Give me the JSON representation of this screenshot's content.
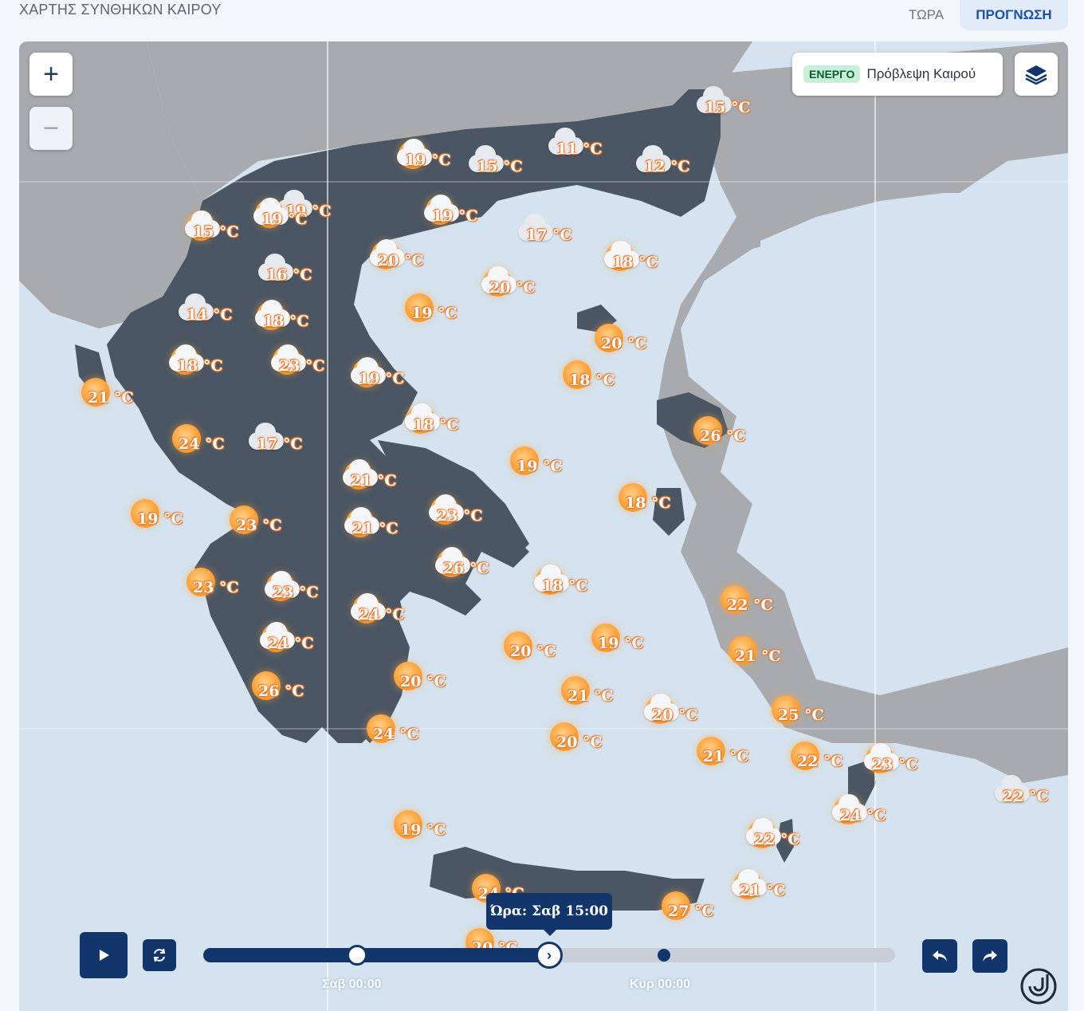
{
  "header": {
    "title": "ΧΑΡΤΗΣ ΣΥΝΘΗΚΩΝ ΚΑΙΡΟΥ",
    "tabs": [
      {
        "label": "ΤΩΡΑ",
        "active": false
      },
      {
        "label": "ΠΡΟΓΝΩΣΗ",
        "active": true
      }
    ]
  },
  "map": {
    "zoom_in_label": "+",
    "zoom_out_label": "−",
    "layer_status_badge": "ΕΝΕΡΓΟ",
    "layer_name": "Πρόβλεψη Καιρού",
    "layers_icon": "layers-icon",
    "colors": {
      "sea": "#d4e3ef",
      "greece_land": "#4a5663",
      "neighbor_land": "#a8aaad",
      "accent": "#12356b"
    }
  },
  "stations": [
    {
      "temp": "15 °C",
      "cond": "cloudy"
    },
    {
      "temp": "19 °C",
      "cond": "partly"
    },
    {
      "temp": "15 °C",
      "cond": "cloudy"
    },
    {
      "temp": "11 °C",
      "cond": "cloudy"
    },
    {
      "temp": "12 °C",
      "cond": "cloudy"
    },
    {
      "temp": "19 °C",
      "cond": "partly"
    },
    {
      "temp": "15 °C",
      "cond": "partly"
    },
    {
      "temp": "19 °C",
      "cond": "cloudy"
    },
    {
      "temp": "17 °C",
      "cond": "cloudy"
    },
    {
      "temp": "16 °C",
      "cond": "cloudy"
    },
    {
      "temp": "20 °C",
      "cond": "partly"
    },
    {
      "temp": "18 °C",
      "cond": "partly"
    },
    {
      "temp": "19 °C",
      "cond": "partly"
    },
    {
      "temp": "14 °C",
      "cond": "cloudy"
    },
    {
      "temp": "18 °C",
      "cond": "partly"
    },
    {
      "temp": "19 °C",
      "cond": "sunny"
    },
    {
      "temp": "20 °C",
      "cond": "partly"
    },
    {
      "temp": "20 °C",
      "cond": "sunny"
    },
    {
      "temp": "18 °C",
      "cond": "partly"
    },
    {
      "temp": "23 °C",
      "cond": "partly"
    },
    {
      "temp": "19 °C",
      "cond": "partly"
    },
    {
      "temp": "18 °C",
      "cond": "sunny"
    },
    {
      "temp": "21 °C",
      "cond": "sunny"
    },
    {
      "temp": "18 °C",
      "cond": "partly"
    },
    {
      "temp": "26 °C",
      "cond": "sunny"
    },
    {
      "temp": "24 °C",
      "cond": "sunny"
    },
    {
      "temp": "17 °C",
      "cond": "cloudy"
    },
    {
      "temp": "21 °C",
      "cond": "partly"
    },
    {
      "temp": "19 °C",
      "cond": "sunny"
    },
    {
      "temp": "19 °C",
      "cond": "sunny"
    },
    {
      "temp": "23 °C",
      "cond": "sunny"
    },
    {
      "temp": "23 °C",
      "cond": "partly"
    },
    {
      "temp": "21 °C",
      "cond": "partly"
    },
    {
      "temp": "18 °C",
      "cond": "sunny"
    },
    {
      "temp": "26 °C",
      "cond": "partly"
    },
    {
      "temp": "23 °C",
      "cond": "sunny"
    },
    {
      "temp": "23 °C",
      "cond": "partly"
    },
    {
      "temp": "18 °C",
      "cond": "partly"
    },
    {
      "temp": "22 °C",
      "cond": "sunny"
    },
    {
      "temp": "24 °C",
      "cond": "partly"
    },
    {
      "temp": "24 °C",
      "cond": "partly"
    },
    {
      "temp": "20 °C",
      "cond": "sunny"
    },
    {
      "temp": "19 °C",
      "cond": "sunny"
    },
    {
      "temp": "21 °C",
      "cond": "sunny"
    },
    {
      "temp": "20 °C",
      "cond": "partly"
    },
    {
      "temp": "26 °C",
      "cond": "sunny"
    },
    {
      "temp": "21 °C",
      "cond": "sunny"
    },
    {
      "temp": "20 °C",
      "cond": "sunny"
    },
    {
      "temp": "25 °C",
      "cond": "sunny"
    },
    {
      "temp": "24 °C",
      "cond": "sunny"
    },
    {
      "temp": "20 °C",
      "cond": "sunny"
    },
    {
      "temp": "21 °C",
      "cond": "sunny"
    },
    {
      "temp": "22 °C",
      "cond": "sunny"
    },
    {
      "temp": "23 °C",
      "cond": "partly"
    },
    {
      "temp": "22 °C",
      "cond": "cloudy"
    },
    {
      "temp": "24 °C",
      "cond": "partly"
    },
    {
      "temp": "19 °C",
      "cond": "sunny"
    },
    {
      "temp": "22 °C",
      "cond": "partly"
    },
    {
      "temp": "24 °C",
      "cond": "sunny"
    },
    {
      "temp": "27 °C",
      "cond": "sunny"
    },
    {
      "temp": "21 °C",
      "cond": "partly"
    },
    {
      "temp": "20 °C",
      "cond": "sunny"
    }
  ],
  "timeline": {
    "play_icon": "play-icon",
    "loop_icon": "loop-icon",
    "tooltip": "Ώρα: Σαβ 15:00",
    "tick_labels": [
      "Σαβ 00:00",
      "Κυρ 00:00"
    ],
    "progress": 0.5,
    "back_icon": "reply-icon",
    "forward_icon": "forward-icon"
  }
}
